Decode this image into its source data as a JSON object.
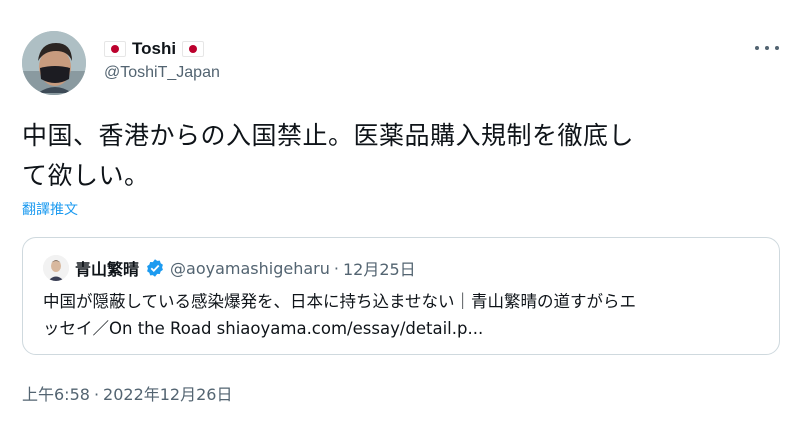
{
  "author": {
    "display_name": "Toshi",
    "handle": "@ToshiT_Japan"
  },
  "tweet": {
    "text_line1": "中国、香港からの入国禁止。医薬品購入規制を徹底し",
    "text_line2": "て欲しい。",
    "translate_label": "翻譯推文"
  },
  "quoted_tweet": {
    "author_name": "青山繁晴",
    "author_handle": "@aoyamashigeharu",
    "separator": "·",
    "date": "12月25日",
    "text_line1": "中国が隠蔽している感染爆発を、日本に持ち込ませない｜青山繁晴の道すがらエ",
    "text_line2": "ッセイ／On the Road shiaoyama.com/essay/detail.p..."
  },
  "footer": {
    "time": "上午6:58",
    "separator": "·",
    "date": "2022年12月26日"
  },
  "colors": {
    "text": "#0f1419",
    "secondary": "#536471",
    "link": "#1d9bf0",
    "border": "#cfd9de",
    "flag_red": "#bc002d"
  },
  "icons": {
    "flag": "japan-flag-icon",
    "more": "more-options-icon",
    "verified": "verified-badge-icon"
  }
}
